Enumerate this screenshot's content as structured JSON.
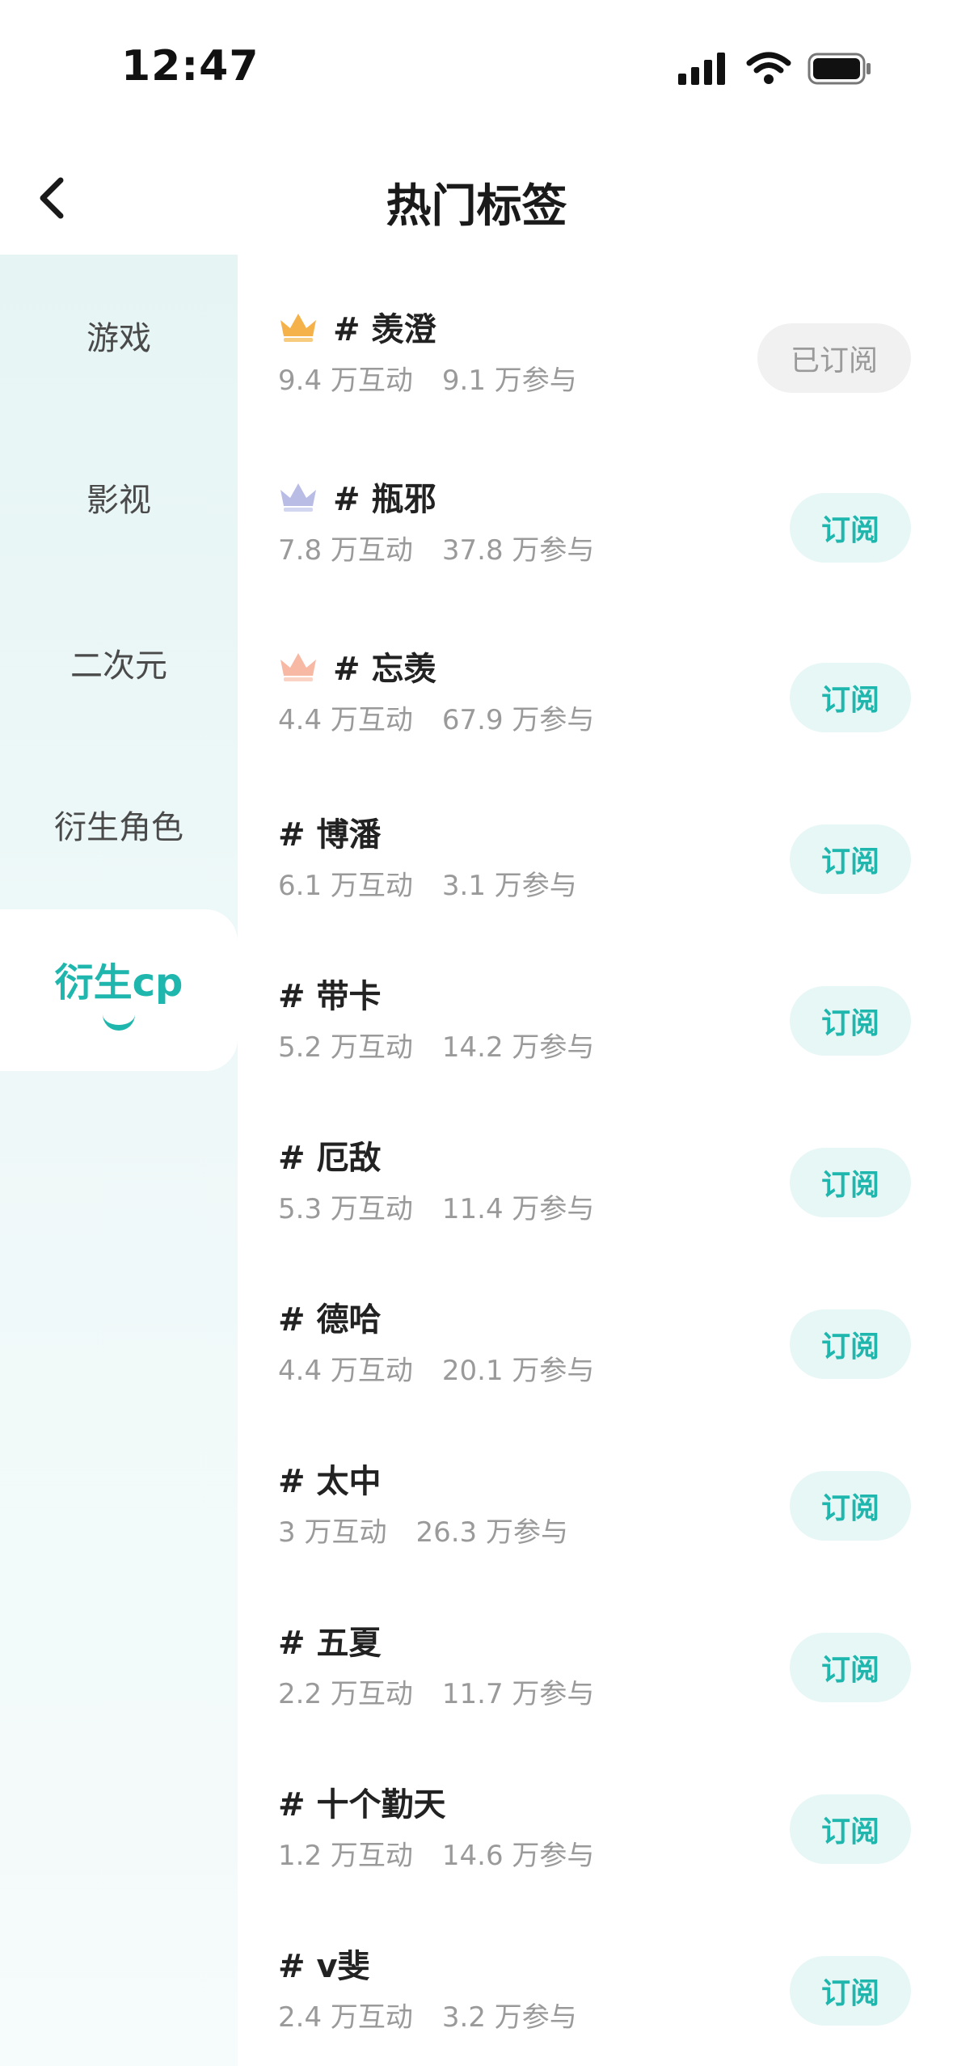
{
  "status": {
    "time": "12:47"
  },
  "header": {
    "title": "热门标签"
  },
  "sidebar": {
    "items": [
      {
        "label": "游戏"
      },
      {
        "label": "影视"
      },
      {
        "label": "二次元"
      },
      {
        "label": "衍生角色"
      },
      {
        "label": "衍生cp",
        "active": true
      }
    ]
  },
  "list": {
    "items": [
      {
        "tag": "# 羡澄",
        "interactions": "9.4 万互动",
        "participants": "9.1 万参与",
        "button": "已订阅",
        "crown": "gold-crown-icon"
      },
      {
        "tag": "# 瓶邪",
        "interactions": "7.8 万互动",
        "participants": "37.8 万参与",
        "button": "订阅",
        "crown": "silver-crown-icon"
      },
      {
        "tag": "# 忘羡",
        "interactions": "4.4 万互动",
        "participants": "67.9 万参与",
        "button": "订阅",
        "crown": "bronze-crown-icon"
      },
      {
        "tag": "# 博潘",
        "interactions": "6.1 万互动",
        "participants": "3.1 万参与",
        "button": "订阅"
      },
      {
        "tag": "# 带卡",
        "interactions": "5.2 万互动",
        "participants": "14.2 万参与",
        "button": "订阅"
      },
      {
        "tag": "# 厄敌",
        "interactions": "5.3 万互动",
        "participants": "11.4 万参与",
        "button": "订阅"
      },
      {
        "tag": "# 德哈",
        "interactions": "4.4 万互动",
        "participants": "20.1 万参与",
        "button": "订阅"
      },
      {
        "tag": "# 太中",
        "interactions": "3 万互动",
        "participants": "26.3 万参与",
        "button": "订阅"
      },
      {
        "tag": "# 五夏",
        "interactions": "2.2 万互动",
        "participants": "11.7 万参与",
        "button": "订阅"
      },
      {
        "tag": "# 十个勤天",
        "interactions": "1.2 万互动",
        "participants": "14.6 万参与",
        "button": "订阅"
      },
      {
        "tag": "# v斐",
        "interactions": "2.4 万互动",
        "participants": "3.2 万参与",
        "button": "订阅"
      }
    ]
  },
  "colors": {
    "accent": "#1fb7ad",
    "button_bg": "#e7f7f6",
    "muted_text": "#9a9a9a",
    "gold": "#f5b24a",
    "silver": "#b9bde6",
    "bronze": "#f7b9a4"
  }
}
